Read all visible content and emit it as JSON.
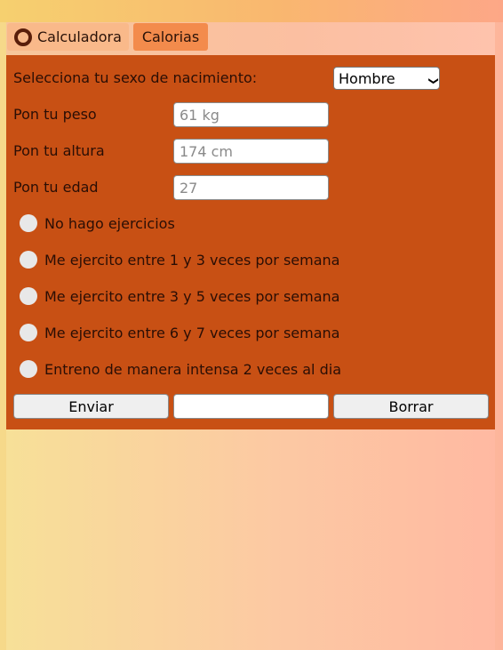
{
  "tabs": [
    {
      "label": "Calculadora"
    },
    {
      "label": "Calorias"
    }
  ],
  "form": {
    "sex_label": "Selecciona tu sexo de nacimiento:",
    "sex_value": "Hombre",
    "weight_label": "Pon tu peso",
    "weight_placeholder": "61 kg",
    "height_label": "Pon tu altura",
    "height_placeholder": "174 cm",
    "age_label": "Pon tu edad",
    "age_placeholder": "27",
    "activity": [
      {
        "label": "No hago ejercicios"
      },
      {
        "label": "Me ejercito entre 1 y 3 veces por semana"
      },
      {
        "label": "Me ejercito entre 3 y 5 veces por semana"
      },
      {
        "label": "Me ejercito entre 6 y 7 veces por semana"
      },
      {
        "label": "Entreno de manera intensa 2 veces al dia"
      }
    ],
    "submit_label": "Enviar",
    "result_value": "",
    "clear_label": "Borrar"
  },
  "colors": {
    "panel": "#c85014",
    "tab_active": "#f38b4c"
  },
  "icons": {
    "calc_tab_icon": "ring-icon",
    "select_arrow": "chevron-down-icon"
  }
}
